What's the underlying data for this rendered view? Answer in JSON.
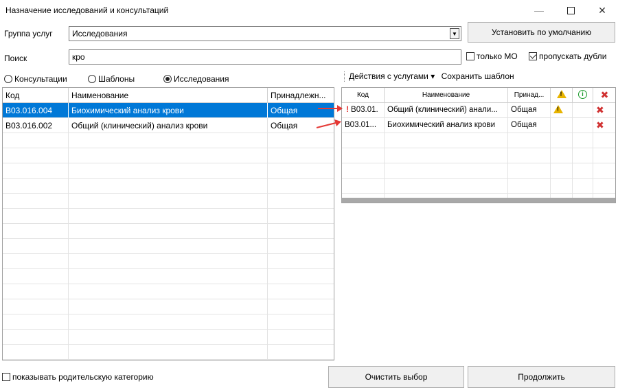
{
  "window": {
    "title": "Назначение исследований и консультаций"
  },
  "group": {
    "label": "Группа услуг",
    "value": "Исследования",
    "default_button": "Установить по умолчанию"
  },
  "search": {
    "label": "Поиск",
    "value": "кро",
    "only_mo": "только МО",
    "skip_dups": "пропускать дубли"
  },
  "tabs": {
    "consult": "Консультации",
    "templates": "Шаблоны",
    "research": "Исследования",
    "selected": "research"
  },
  "left_table": {
    "headers": [
      "Код",
      "Наименование",
      "Принадлежн..."
    ],
    "rows": [
      [
        "B03.016.004",
        "Биохимический анализ крови",
        "Общая"
      ],
      [
        "B03.016.002",
        "Общий (клинический) анализ крови",
        "Общая"
      ]
    ]
  },
  "toolbar": {
    "actions": "Действия с услугами",
    "actions_arrow": "▾",
    "save_template": "Сохранить шаблон"
  },
  "right_table": {
    "headers": [
      "Код",
      "Наименование",
      "Принад..."
    ],
    "rows": [
      {
        "mark": "!",
        "code": "B03.01.",
        "name": "Общий (клинический) анали...",
        "owner": "Общая",
        "warn": true
      },
      {
        "mark": "",
        "code": "B03.01...",
        "name": "Биохимический анализ крови",
        "owner": "Общая",
        "warn": false
      }
    ]
  },
  "footer": {
    "show_parent": "показывать родительскую категорию",
    "clear_button": "Очистить выбор",
    "continue_button": "Продолжить"
  },
  "colors": {
    "selection": "#0078d7",
    "warning": "#e8b400",
    "info": "#1a9a2a",
    "delete": "#d03030",
    "arrow": "#e53935"
  }
}
